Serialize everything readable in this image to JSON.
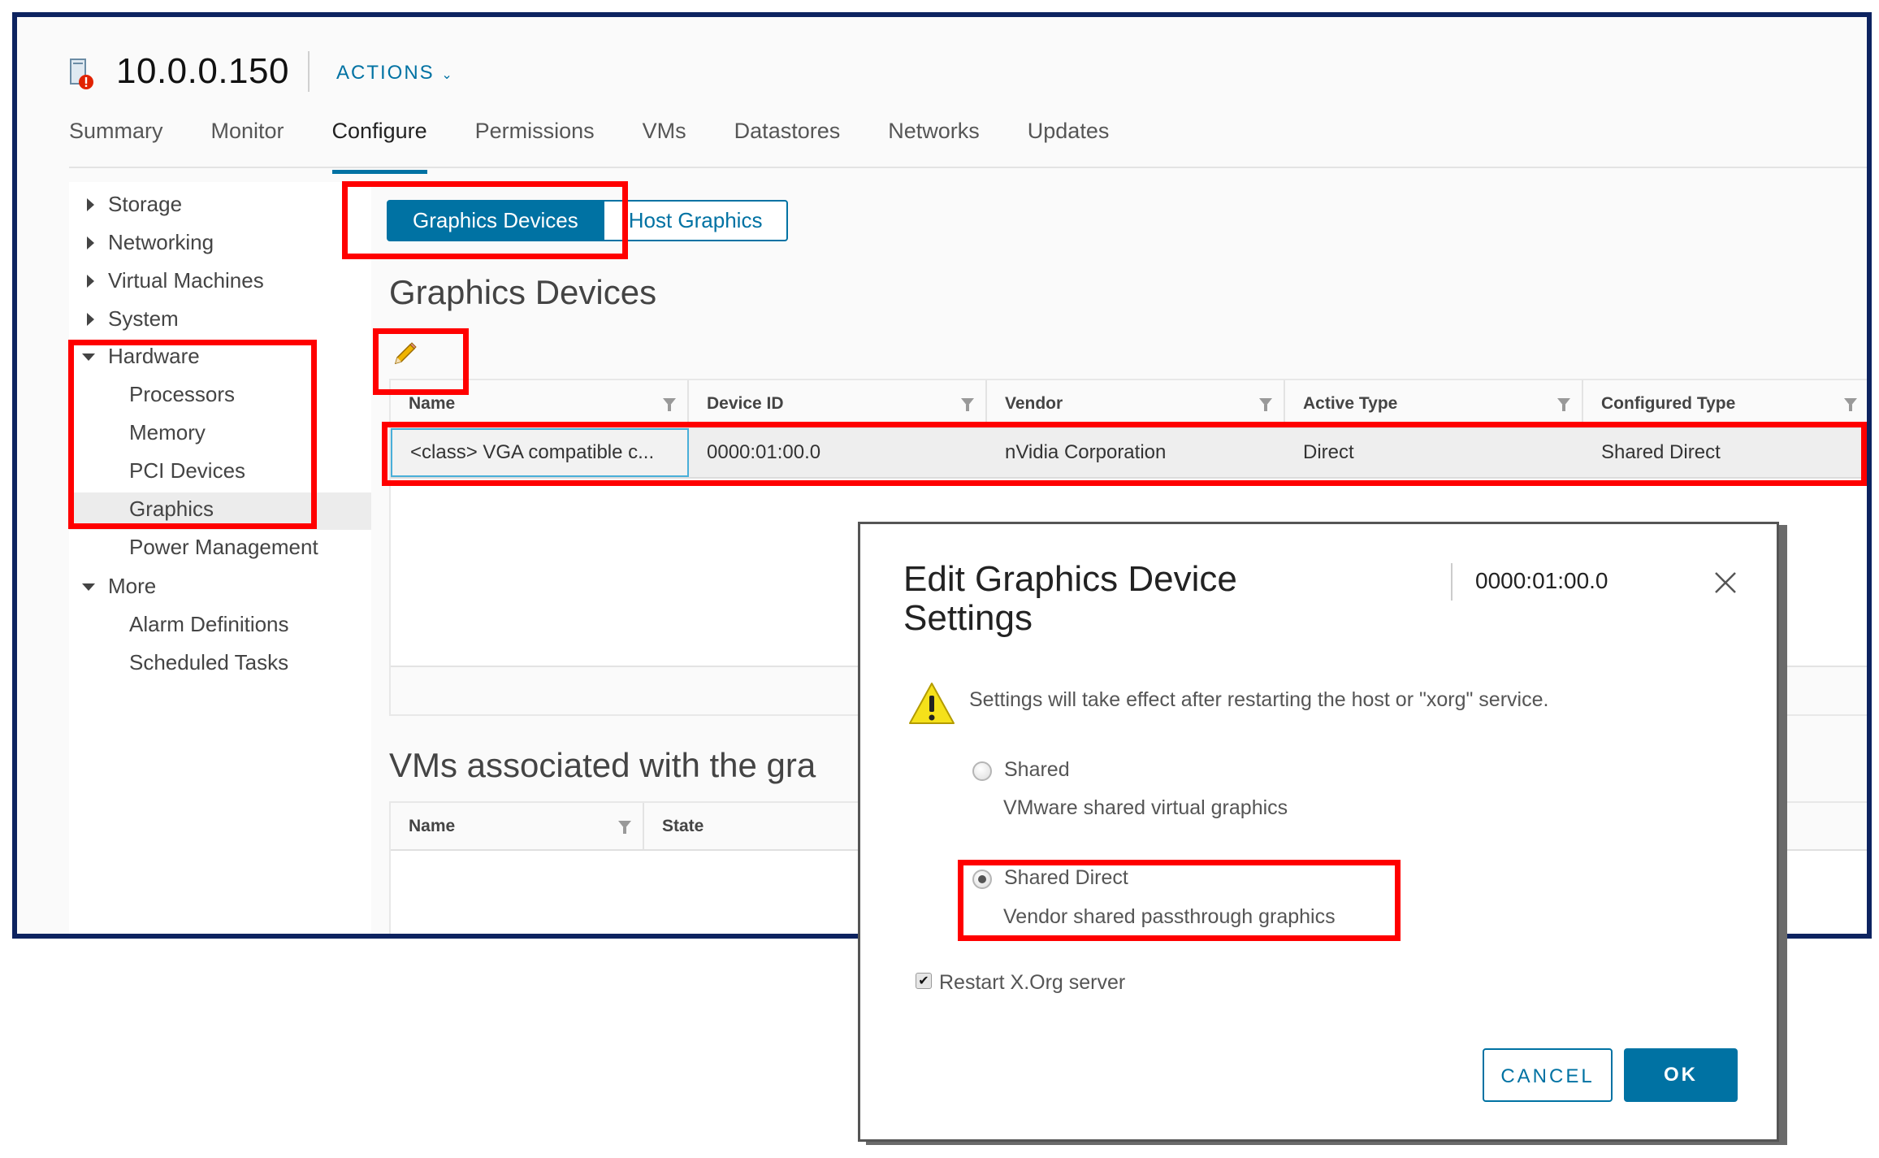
{
  "header": {
    "host_name": "10.0.0.150",
    "actions_label": "ACTIONS",
    "host_icon": "host-warning-icon"
  },
  "tabs": [
    {
      "label": "Summary",
      "active": false
    },
    {
      "label": "Monitor",
      "active": false
    },
    {
      "label": "Configure",
      "active": true
    },
    {
      "label": "Permissions",
      "active": false
    },
    {
      "label": "VMs",
      "active": false
    },
    {
      "label": "Datastores",
      "active": false
    },
    {
      "label": "Networks",
      "active": false
    },
    {
      "label": "Updates",
      "active": false
    }
  ],
  "sidebar": {
    "items": [
      {
        "label": "Storage",
        "level": 0,
        "expanded": false
      },
      {
        "label": "Networking",
        "level": 0,
        "expanded": false
      },
      {
        "label": "Virtual Machines",
        "level": 0,
        "expanded": false
      },
      {
        "label": "System",
        "level": 0,
        "expanded": false
      },
      {
        "label": "Hardware",
        "level": 0,
        "expanded": true
      },
      {
        "label": "Processors",
        "level": 1
      },
      {
        "label": "Memory",
        "level": 1
      },
      {
        "label": "PCI Devices",
        "level": 1
      },
      {
        "label": "Graphics",
        "level": 1,
        "selected": true
      },
      {
        "label": "Power Management",
        "level": 1
      },
      {
        "label": "More",
        "level": 0,
        "expanded": true
      },
      {
        "label": "Alarm Definitions",
        "level": 1
      },
      {
        "label": "Scheduled Tasks",
        "level": 1
      }
    ]
  },
  "segment": {
    "graphics_devices": "Graphics Devices",
    "host_graphics": "Host Graphics"
  },
  "graphics_devices": {
    "title": "Graphics Devices",
    "edit_icon": "pencil-icon",
    "columns": [
      "Name",
      "Device ID",
      "Vendor",
      "Active Type",
      "Configured Type"
    ],
    "rows": [
      [
        "<class> VGA compatible c...",
        "0000:01:00.0",
        "nVidia Corporation",
        "Direct",
        "Shared Direct"
      ]
    ]
  },
  "vms_section": {
    "title": "VMs associated with the gra",
    "columns": [
      "Name",
      "State"
    ]
  },
  "dialog": {
    "title": "Edit Graphics Device Settings",
    "device_id": "0000:01:00.0",
    "warning": "Settings will take effect after restarting the host or \"xorg\" service.",
    "options": [
      {
        "label": "Shared",
        "description": "VMware shared virtual graphics",
        "selected": false
      },
      {
        "label": "Shared Direct",
        "description": "Vendor shared passthrough graphics",
        "selected": true
      }
    ],
    "restart_checkbox": {
      "label": "Restart X.Org server",
      "checked": true
    },
    "cancel_label": "CANCEL",
    "ok_label": "OK"
  },
  "colors": {
    "accent": "#0072a3",
    "highlight_box": "#ff0000",
    "frame_border": "#0d2360"
  }
}
